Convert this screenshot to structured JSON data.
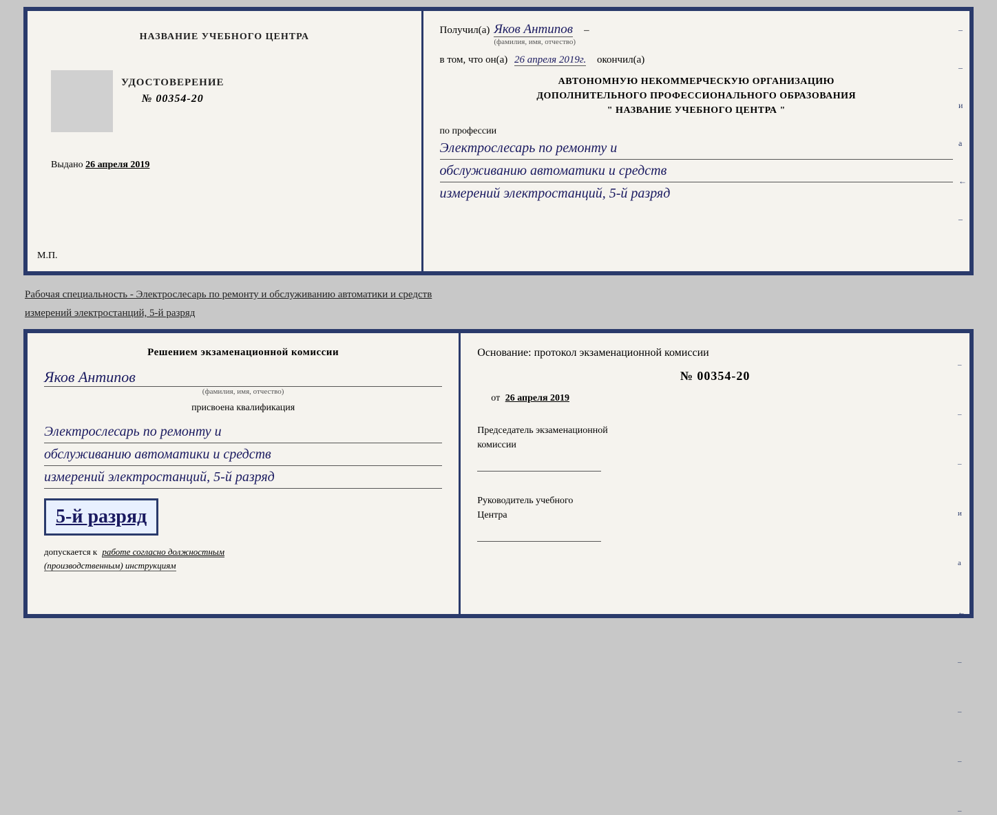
{
  "top": {
    "left": {
      "header": "НАЗВАНИЕ УЧЕБНОГО ЦЕНТРА",
      "cert_label": "УДОСТОВЕРЕНИЕ",
      "cert_number": "№ 00354-20",
      "issued_label": "Выдано",
      "issued_date": "26 апреля 2019",
      "mp": "М.П."
    },
    "right": {
      "received_label": "Получил(а)",
      "recipient_name": "Яков Антипов",
      "fio_subtext": "(фамилия, имя, отчество)",
      "in_that_label": "в том, что он(а)",
      "date_completed": "26 апреля 2019г.",
      "finished_label": "окончил(а)",
      "org_line1": "АВТОНОМНУЮ НЕКОММЕРЧЕСКУЮ ОРГАНИЗАЦИЮ",
      "org_line2": "ДОПОЛНИТЕЛЬНОГО ПРОФЕССИОНАЛЬНОГО ОБРАЗОВАНИЯ",
      "org_line3": "\"  НАЗВАНИЕ УЧЕБНОГО ЦЕНТРА  \"",
      "profession_label": "по профессии",
      "profession_line1": "Электрослесарь по ремонту и",
      "profession_line2": "обслуживанию автоматики и средств",
      "profession_line3": "измерений электростанций, 5-й разряд"
    }
  },
  "specialty_text": "Рабочая специальность - Электрослесарь по ремонту и обслуживанию автоматики и средств",
  "specialty_text2": "измерений электростанций, 5-й разряд",
  "bottom": {
    "left": {
      "decision_label": "Решением экзаменационной комиссии",
      "name": "Яков Антипов",
      "fio_subtext": "(фамилия, имя, отчество)",
      "assigned_label": "присвоена квалификация",
      "qual_line1": "Электрослесарь по ремонту и",
      "qual_line2": "обслуживанию автоматики и средств",
      "qual_line3": "измерений электростанций, 5-й разряд",
      "grade_text": "5-й разряд",
      "допуск_prefix": "допускается к",
      "допуск_underline": "работе согласно должностным",
      "допуск_italic": "(производственным) инструкциям"
    },
    "right": {
      "basis_label": "Основание: протокол экзаменационной комиссии",
      "protocol_number": "№  00354-20",
      "from_label": "от",
      "from_date": "26 апреля 2019",
      "chairman_line1": "Председатель экзаменационной",
      "chairman_line2": "комиссии",
      "director_line1": "Руководитель учебного",
      "director_line2": "Центра"
    }
  }
}
